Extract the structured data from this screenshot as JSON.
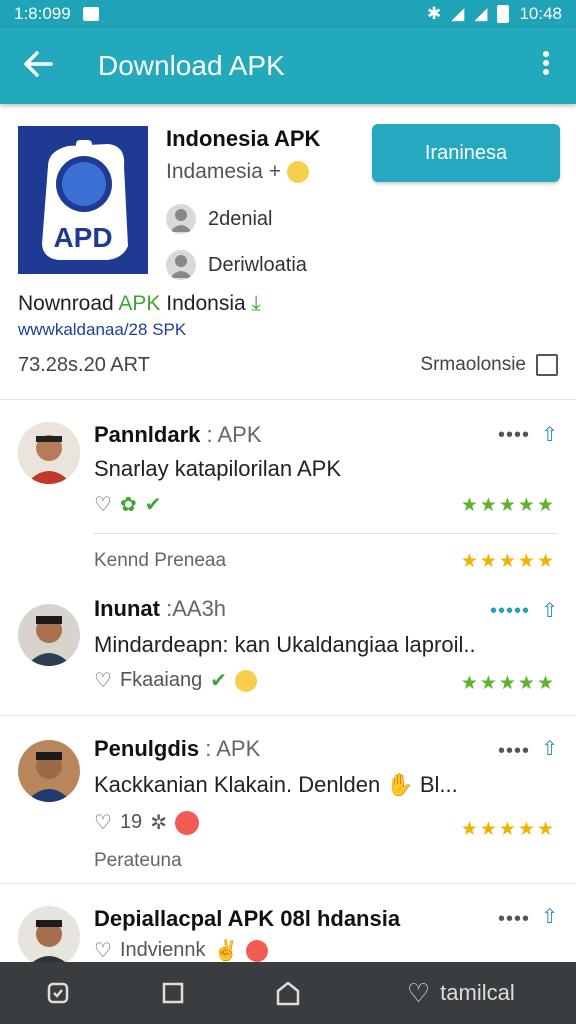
{
  "status": {
    "time_left": "1:8:099",
    "time_right": "10:48"
  },
  "appbar": {
    "title": "Download APK"
  },
  "app": {
    "name": "Indonesia APK",
    "subtitle": "Indamesia + ",
    "meta1": "2denial",
    "meta2": "Deriwloatia",
    "install_label": "Iraninesa",
    "download_text_pre": "Nownroad ",
    "download_text_accent": "APK",
    "download_text_post": " Indonsia",
    "url": "wwwkaldanaa/28 SPK",
    "version": "73.28s.20 ART",
    "share_label": "Srmaolonsie",
    "icon_label": "APD"
  },
  "reviews": [
    {
      "name": "Pannldark",
      "tag": " : APK",
      "text": "Snarlay katapilorilan APK",
      "footer": "Kennd Preneaa",
      "stars": "★★★★★"
    },
    {
      "name": "Inunat",
      "tag": " :AA3h",
      "text": "Mindardeapn: kan Ukaldangiaa laproil..",
      "actions": "Fkaaiang",
      "stars": "★★★★★"
    },
    {
      "name": "Penulgdis",
      "tag": " : APK",
      "text": "Kackkanian Klakain. Denlden",
      "text_tail": " Bl...",
      "actions": "19",
      "footer": "Perateuna",
      "stars": "★★★★★"
    },
    {
      "name": "Depiallacpal APK 08l hdansia",
      "actions": "Indviennk"
    }
  ],
  "navbar": {
    "right_label": "tamilcal"
  },
  "colors": {
    "primary": "#22a9bc",
    "accent_green": "#3fa535",
    "star": "#f0b400",
    "navbar": "#3a3d3f"
  }
}
